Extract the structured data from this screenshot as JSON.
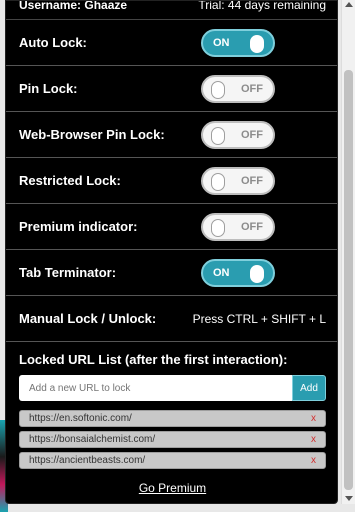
{
  "top_row": {
    "username_label": "Username: Ghaaze",
    "trial_text": "Trial: 44 days remaining"
  },
  "settings": [
    {
      "label": "Auto Lock:",
      "state": "ON"
    },
    {
      "label": "Pin Lock:",
      "state": "OFF"
    },
    {
      "label": "Web-Browser Pin Lock:",
      "state": "OFF"
    },
    {
      "label": "Restricted Lock:",
      "state": "OFF"
    },
    {
      "label": "Premium indicator:",
      "state": "OFF"
    },
    {
      "label": "Tab Terminator:",
      "state": "ON"
    }
  ],
  "manual_lock": {
    "label": "Manual Lock / Unlock:",
    "value": "Press CTRL + SHIFT + L"
  },
  "url_list": {
    "heading": "Locked URL List (after the first interaction):",
    "input_placeholder": "Add a new URL to lock",
    "add_label": "Add",
    "items": [
      {
        "url": "https://en.softonic.com/",
        "remove": "x"
      },
      {
        "url": "https://bonsaialchemist.com/",
        "remove": "x"
      },
      {
        "url": "https://ancientbeasts.com/",
        "remove": "x"
      }
    ]
  },
  "go_premium": "Go Premium",
  "colors": {
    "accent": "#2a9db0",
    "panel_bg": "#000000",
    "remove": "#d32f2f"
  }
}
